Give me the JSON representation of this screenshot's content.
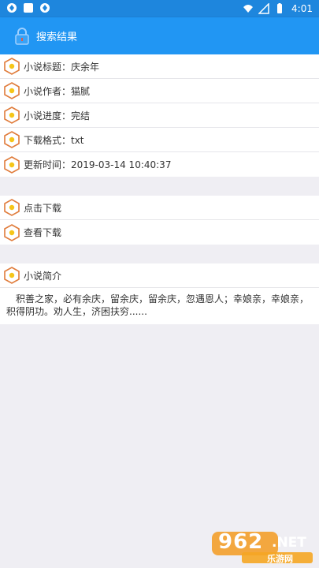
{
  "status_bar": {
    "time": "4:01"
  },
  "app_bar": {
    "title": "搜索结果"
  },
  "info": {
    "title_label": "小说标题：庆余年",
    "author_label": "小说作者：猫腻",
    "progress_label": "小说进度：完结",
    "format_label": "下载格式：txt",
    "updated_label": "更新时间：2019-03-14 10:40:37"
  },
  "actions": {
    "download_label": "点击下载",
    "view_label": "查看下载"
  },
  "summary": {
    "heading": "小说简介",
    "text": "积善之家，必有余庆，留余庆，留余庆，忽遇恩人；幸娘亲，幸娘亲，积得阴功。劝人生，济困扶穷......"
  },
  "watermark": {
    "brand": "962",
    "suffix": ".NET",
    "subtitle": "乐游网"
  },
  "colors": {
    "appbar": "#2196f3",
    "statusbar": "#1e86dd",
    "hex_icon_border": "#e07b3a",
    "hex_icon_fill": "#f5c518",
    "background": "#efeef3"
  }
}
